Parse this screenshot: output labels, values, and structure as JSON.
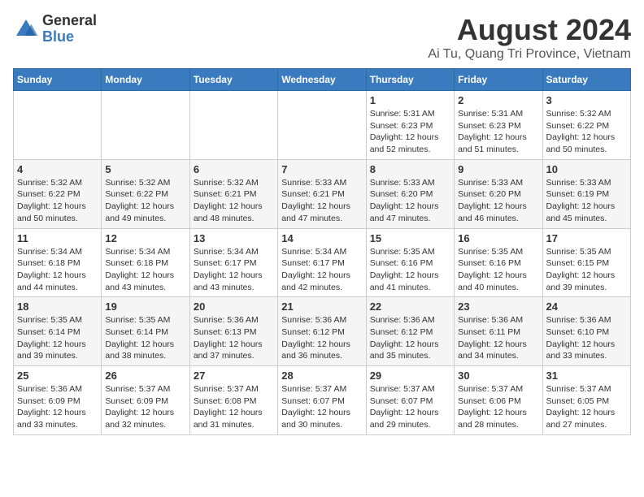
{
  "header": {
    "logo_general": "General",
    "logo_blue": "Blue",
    "month_title": "August 2024",
    "location": "Ai Tu, Quang Tri Province, Vietnam"
  },
  "weekdays": [
    "Sunday",
    "Monday",
    "Tuesday",
    "Wednesday",
    "Thursday",
    "Friday",
    "Saturday"
  ],
  "weeks": [
    [
      {
        "day": "",
        "info": ""
      },
      {
        "day": "",
        "info": ""
      },
      {
        "day": "",
        "info": ""
      },
      {
        "day": "",
        "info": ""
      },
      {
        "day": "1",
        "info": "Sunrise: 5:31 AM\nSunset: 6:23 PM\nDaylight: 12 hours\nand 52 minutes."
      },
      {
        "day": "2",
        "info": "Sunrise: 5:31 AM\nSunset: 6:23 PM\nDaylight: 12 hours\nand 51 minutes."
      },
      {
        "day": "3",
        "info": "Sunrise: 5:32 AM\nSunset: 6:22 PM\nDaylight: 12 hours\nand 50 minutes."
      }
    ],
    [
      {
        "day": "4",
        "info": "Sunrise: 5:32 AM\nSunset: 6:22 PM\nDaylight: 12 hours\nand 50 minutes."
      },
      {
        "day": "5",
        "info": "Sunrise: 5:32 AM\nSunset: 6:22 PM\nDaylight: 12 hours\nand 49 minutes."
      },
      {
        "day": "6",
        "info": "Sunrise: 5:32 AM\nSunset: 6:21 PM\nDaylight: 12 hours\nand 48 minutes."
      },
      {
        "day": "7",
        "info": "Sunrise: 5:33 AM\nSunset: 6:21 PM\nDaylight: 12 hours\nand 47 minutes."
      },
      {
        "day": "8",
        "info": "Sunrise: 5:33 AM\nSunset: 6:20 PM\nDaylight: 12 hours\nand 47 minutes."
      },
      {
        "day": "9",
        "info": "Sunrise: 5:33 AM\nSunset: 6:20 PM\nDaylight: 12 hours\nand 46 minutes."
      },
      {
        "day": "10",
        "info": "Sunrise: 5:33 AM\nSunset: 6:19 PM\nDaylight: 12 hours\nand 45 minutes."
      }
    ],
    [
      {
        "day": "11",
        "info": "Sunrise: 5:34 AM\nSunset: 6:18 PM\nDaylight: 12 hours\nand 44 minutes."
      },
      {
        "day": "12",
        "info": "Sunrise: 5:34 AM\nSunset: 6:18 PM\nDaylight: 12 hours\nand 43 minutes."
      },
      {
        "day": "13",
        "info": "Sunrise: 5:34 AM\nSunset: 6:17 PM\nDaylight: 12 hours\nand 43 minutes."
      },
      {
        "day": "14",
        "info": "Sunrise: 5:34 AM\nSunset: 6:17 PM\nDaylight: 12 hours\nand 42 minutes."
      },
      {
        "day": "15",
        "info": "Sunrise: 5:35 AM\nSunset: 6:16 PM\nDaylight: 12 hours\nand 41 minutes."
      },
      {
        "day": "16",
        "info": "Sunrise: 5:35 AM\nSunset: 6:16 PM\nDaylight: 12 hours\nand 40 minutes."
      },
      {
        "day": "17",
        "info": "Sunrise: 5:35 AM\nSunset: 6:15 PM\nDaylight: 12 hours\nand 39 minutes."
      }
    ],
    [
      {
        "day": "18",
        "info": "Sunrise: 5:35 AM\nSunset: 6:14 PM\nDaylight: 12 hours\nand 39 minutes."
      },
      {
        "day": "19",
        "info": "Sunrise: 5:35 AM\nSunset: 6:14 PM\nDaylight: 12 hours\nand 38 minutes."
      },
      {
        "day": "20",
        "info": "Sunrise: 5:36 AM\nSunset: 6:13 PM\nDaylight: 12 hours\nand 37 minutes."
      },
      {
        "day": "21",
        "info": "Sunrise: 5:36 AM\nSunset: 6:12 PM\nDaylight: 12 hours\nand 36 minutes."
      },
      {
        "day": "22",
        "info": "Sunrise: 5:36 AM\nSunset: 6:12 PM\nDaylight: 12 hours\nand 35 minutes."
      },
      {
        "day": "23",
        "info": "Sunrise: 5:36 AM\nSunset: 6:11 PM\nDaylight: 12 hours\nand 34 minutes."
      },
      {
        "day": "24",
        "info": "Sunrise: 5:36 AM\nSunset: 6:10 PM\nDaylight: 12 hours\nand 33 minutes."
      }
    ],
    [
      {
        "day": "25",
        "info": "Sunrise: 5:36 AM\nSunset: 6:09 PM\nDaylight: 12 hours\nand 33 minutes."
      },
      {
        "day": "26",
        "info": "Sunrise: 5:37 AM\nSunset: 6:09 PM\nDaylight: 12 hours\nand 32 minutes."
      },
      {
        "day": "27",
        "info": "Sunrise: 5:37 AM\nSunset: 6:08 PM\nDaylight: 12 hours\nand 31 minutes."
      },
      {
        "day": "28",
        "info": "Sunrise: 5:37 AM\nSunset: 6:07 PM\nDaylight: 12 hours\nand 30 minutes."
      },
      {
        "day": "29",
        "info": "Sunrise: 5:37 AM\nSunset: 6:07 PM\nDaylight: 12 hours\nand 29 minutes."
      },
      {
        "day": "30",
        "info": "Sunrise: 5:37 AM\nSunset: 6:06 PM\nDaylight: 12 hours\nand 28 minutes."
      },
      {
        "day": "31",
        "info": "Sunrise: 5:37 AM\nSunset: 6:05 PM\nDaylight: 12 hours\nand 27 minutes."
      }
    ]
  ]
}
